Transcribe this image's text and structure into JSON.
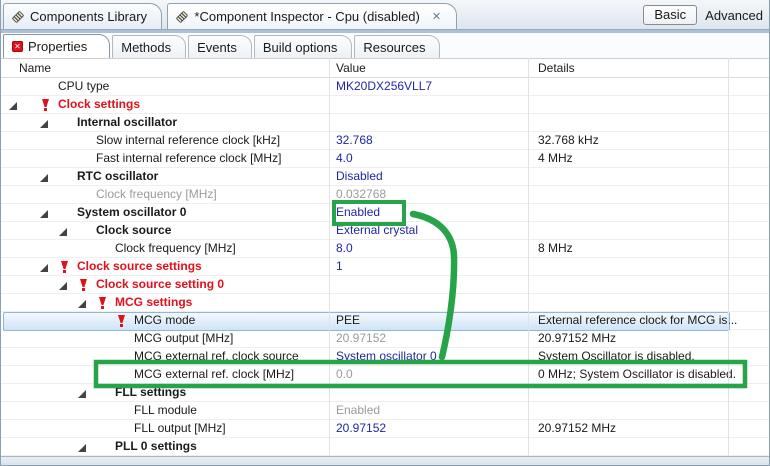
{
  "header_tabs": [
    {
      "label": "Components Library"
    },
    {
      "label": "*Component Inspector - Cpu (disabled)",
      "close_icon": "✕"
    }
  ],
  "view_mode": {
    "basic": "Basic",
    "advanced": "Advanced"
  },
  "inner_tabs": [
    {
      "label": "Properties",
      "has_error": true
    },
    {
      "label": "Methods"
    },
    {
      "label": "Events"
    },
    {
      "label": "Build options"
    },
    {
      "label": "Resources"
    }
  ],
  "table": {
    "columns": [
      "Name",
      "Value",
      "Details"
    ],
    "rows": [
      {
        "name": "CPU type",
        "level": 1,
        "style": "normal",
        "value": "MK20DX256VLL7",
        "value_style": "blue",
        "details": ""
      },
      {
        "name": "Clock settings",
        "level": 1,
        "style": "redbold",
        "expand": true,
        "error": true,
        "value": "",
        "value_style": "blue",
        "details": ""
      },
      {
        "name": "Internal oscillator",
        "level": 2,
        "style": "bold",
        "expand": true,
        "value": "",
        "value_style": "blue",
        "details": ""
      },
      {
        "name": "Slow internal reference clock [kHz]",
        "level": 3,
        "style": "normal",
        "value": "32.768",
        "value_style": "blue",
        "details": "32.768 kHz"
      },
      {
        "name": "Fast internal reference clock [MHz]",
        "level": 3,
        "style": "normal",
        "value": "4.0",
        "value_style": "blue",
        "details": "4 MHz"
      },
      {
        "name": "RTC oscillator",
        "level": 2,
        "style": "bold",
        "expand": true,
        "value": "Disabled",
        "value_style": "blue",
        "details": ""
      },
      {
        "name": "Clock frequency [MHz]",
        "level": 3,
        "style": "gray",
        "value": "0.032768",
        "value_style": "gray",
        "details": ""
      },
      {
        "name": "System oscillator 0",
        "level": 2,
        "style": "bold",
        "expand": true,
        "value": "Enabled",
        "value_style": "blue",
        "details": ""
      },
      {
        "name": "Clock source",
        "level": 3,
        "style": "bold",
        "expand": true,
        "value": "External crystal",
        "value_style": "blue",
        "details": ""
      },
      {
        "name": "Clock frequency [MHz]",
        "level": 4,
        "style": "normal",
        "value": "8.0",
        "value_style": "blue",
        "details": "8 MHz"
      },
      {
        "name": "Clock source settings",
        "level": 2,
        "style": "redbold",
        "expand": true,
        "error": true,
        "value": "1",
        "value_style": "blue",
        "details": ""
      },
      {
        "name": "Clock source setting 0",
        "level": 3,
        "style": "redbold",
        "expand": true,
        "error": true,
        "value": "",
        "value_style": "blue",
        "details": ""
      },
      {
        "name": "MCG settings",
        "level": 4,
        "style": "redbold",
        "expand": true,
        "error": true,
        "value": "",
        "value_style": "blue",
        "details": ""
      },
      {
        "name": "MCG mode",
        "level": 5,
        "style": "normal",
        "error": true,
        "selected": true,
        "value": "PEE",
        "value_style": "black",
        "details": "External reference clock for MCG is..."
      },
      {
        "name": "MCG output [MHz]",
        "level": 5,
        "style": "normal",
        "value": "20.97152",
        "value_style": "gray",
        "details": "20.97152 MHz"
      },
      {
        "name": "MCG external ref. clock source",
        "level": 5,
        "style": "normal",
        "value": "System oscillator 0",
        "value_style": "blue",
        "details": "System Oscillator is disabled."
      },
      {
        "name": "MCG external ref. clock [MHz]",
        "level": 5,
        "style": "normal",
        "value": "0.0",
        "value_style": "gray",
        "details": "0 MHz; System Oscillator is disabled."
      },
      {
        "name": "FLL settings",
        "level": 4,
        "style": "bold",
        "expand": true,
        "value": "",
        "value_style": "blue",
        "details": ""
      },
      {
        "name": "FLL module",
        "level": 5,
        "style": "normal",
        "value": "Enabled",
        "value_style": "gray",
        "details": ""
      },
      {
        "name": "FLL output [MHz]",
        "level": 5,
        "style": "normal",
        "value": "20.97152",
        "value_style": "blue",
        "details": "20.97152 MHz"
      },
      {
        "name": "PLL 0 settings",
        "level": 4,
        "style": "bold",
        "expand": true,
        "value": "",
        "value_style": "blue",
        "details": ""
      }
    ]
  },
  "annotations": {
    "color": "#27a34a",
    "items": [
      "green-box-around-system-oscillator-enabled-value",
      "green-arrow-from-enabled-to-mcg-external-ref-clock-row",
      "green-box-around-mcg-external-ref-clock-row"
    ]
  },
  "colors": {
    "value_blue": "#2026a8",
    "error_red": "#e1111c",
    "disabled_gray": "#9b9b9b",
    "annotation_green": "#27a34a",
    "selection_border": "#8fb6dc"
  }
}
